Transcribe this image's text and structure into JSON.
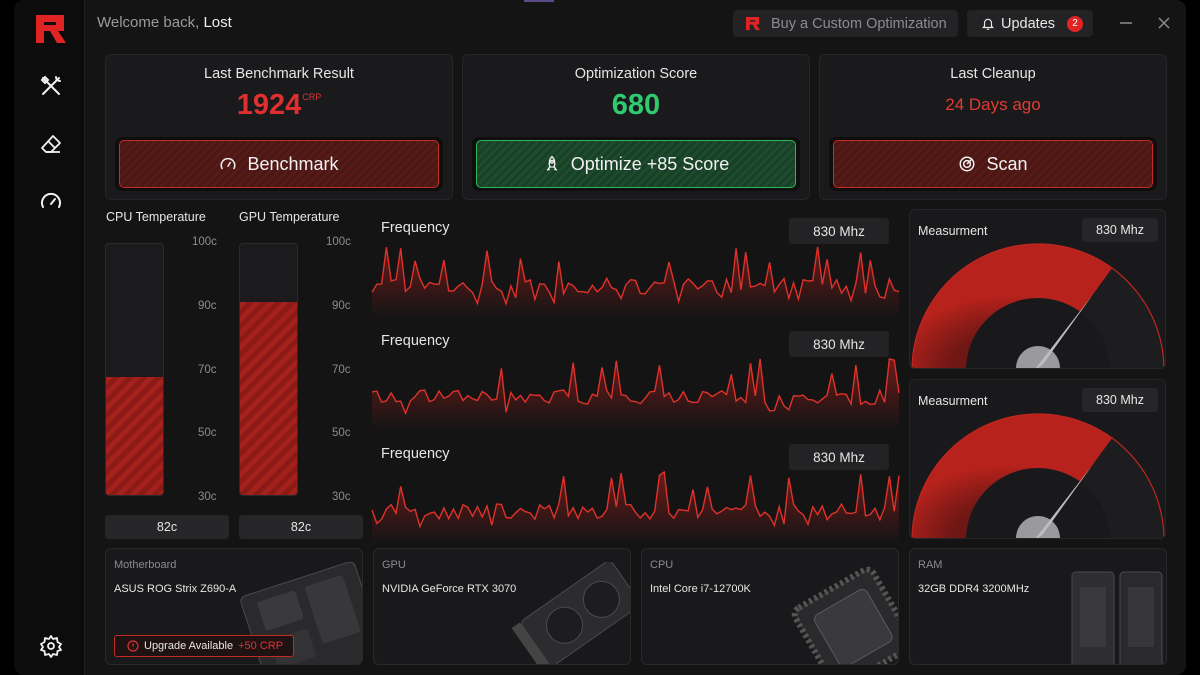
{
  "header": {
    "welcome_prefix": "Welcome back,",
    "username": "Lost",
    "buy_label": "Buy a Custom Optimization",
    "updates_label": "Updates",
    "updates_count": "2"
  },
  "sidebar": {
    "items": [
      {
        "icon": "tools-icon"
      },
      {
        "icon": "eraser-icon"
      },
      {
        "icon": "speedometer-icon"
      }
    ],
    "settings_icon": "gear-icon"
  },
  "cards": {
    "benchmark": {
      "title": "Last Benchmark Result",
      "value": "1924",
      "unit": "CRP",
      "button": "Benchmark"
    },
    "optimization": {
      "title": "Optimization Score",
      "value": "680",
      "button": "Optimize +85 Score"
    },
    "cleanup": {
      "title": "Last Cleanup",
      "value": "24 Days ago",
      "button": "Scan"
    }
  },
  "temperatures": {
    "cpu": {
      "label": "CPU Temperature",
      "value": "82c",
      "level": 0.47
    },
    "gpu": {
      "label": "GPU Temperature",
      "value": "82c",
      "level": 0.77
    },
    "ticks": [
      "100c",
      "90c",
      "70c",
      "50c",
      "30c"
    ]
  },
  "frequencies": [
    {
      "label": "Frequency",
      "value": "830 Mhz"
    },
    {
      "label": "Frequency",
      "value": "830 Mhz"
    },
    {
      "label": "Frequency",
      "value": "830 Mhz"
    }
  ],
  "gauges": [
    {
      "title": "Measurment",
      "value": "830 Mhz",
      "level": 0.7
    },
    {
      "title": "Measurment",
      "value": "830 Mhz",
      "level": 0.7
    }
  ],
  "hardware": {
    "motherboard": {
      "title": "Motherboard",
      "name": "ASUS ROG Strix Z690-A"
    },
    "gpu": {
      "title": "GPU",
      "name": "NVIDIA GeForce RTX 3070"
    },
    "cpu": {
      "title": "CPU",
      "name": "Intel Core i7-12700K"
    },
    "ram": {
      "title": "RAM",
      "name": "32GB DDR4 3200MHz"
    },
    "upgrade": {
      "label": "Upgrade Available",
      "bonus": "+50 CRP"
    }
  },
  "colors": {
    "accent": "#e02424",
    "success": "#2ecc71",
    "warning_text": "#e33a30"
  }
}
